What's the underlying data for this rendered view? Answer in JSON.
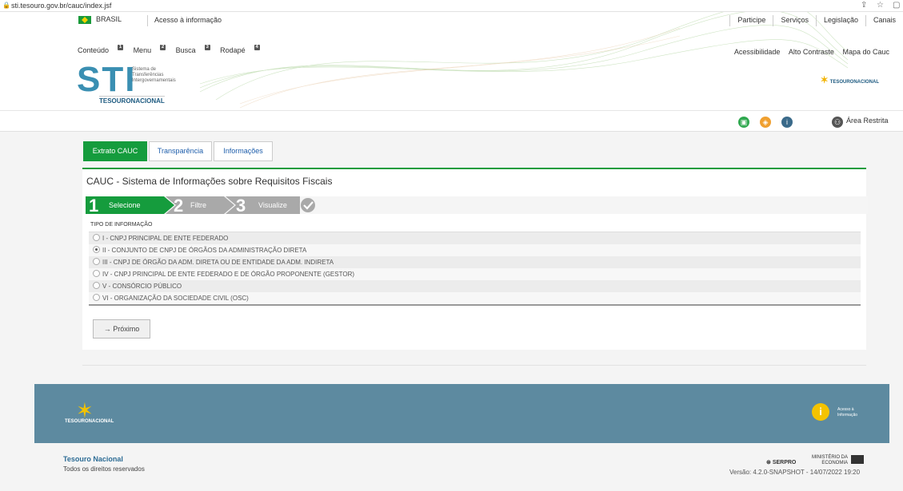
{
  "browser": {
    "url": "sti.tesouro.gov.br/cauc/index.jsf"
  },
  "header": {
    "brasil": "BRASIL",
    "acesso_informacao": "Acesso à informação",
    "right_links": [
      "Participe",
      "Serviços",
      "Legislação",
      "Canais"
    ],
    "shortcuts": [
      {
        "label": "Conteúdo",
        "key": "1"
      },
      {
        "label": "Menu",
        "key": "2"
      },
      {
        "label": "Busca",
        "key": "3"
      },
      {
        "label": "Rodapé",
        "key": "4"
      }
    ],
    "accessibility": [
      "Acessibilidade",
      "Alto Contraste",
      "Mapa do Cauc"
    ],
    "logo": "STI",
    "logo_subtitle": [
      "Sistema de",
      "Transferências",
      "Intergovernamentais"
    ],
    "logo_tesouro": "TESOURONACIONAL",
    "tesouro_right": "TESOURONACIONAL"
  },
  "iconbar": {
    "area_restrita": "Área Restrita"
  },
  "tabs": [
    {
      "label": "Extrato CAUC",
      "active": true
    },
    {
      "label": "Transparência",
      "active": false
    },
    {
      "label": "Informações",
      "active": false
    }
  ],
  "panel": {
    "title": "CAUC - Sistema de Informações sobre Requisitos Fiscais",
    "steps": [
      {
        "num": "1",
        "label": "Selecione"
      },
      {
        "num": "2",
        "label": "Filtre"
      },
      {
        "num": "3",
        "label": "Visualize"
      }
    ],
    "tipo_label": "TIPO DE INFORMAÇÃO",
    "options": [
      "I - CNPJ PRINCIPAL DE ENTE FEDERADO",
      "II - CONJUNTO DE CNPJ DE ÓRGÃOS DA ADMINISTRAÇÃO DIRETA",
      "III - CNPJ DE ÓRGÃO DA ADM. DIRETA OU DE ENTIDADE DA ADM. INDIRETA",
      "IV - CNPJ PRINCIPAL DE ENTE FEDERADO E DE ÓRGÃO PROPONENTE (GESTOR)",
      "V - CONSÓRCIO PÚBLICO",
      "VI - ORGANIZAÇÃO DA SOCIEDADE CIVIL (OSC)"
    ],
    "selected_index": 1,
    "next_button": "Próximo"
  },
  "footer": {
    "tesouro": "TESOURONACIONAL",
    "acesso_text": [
      "Acesso à",
      "Informação"
    ],
    "org": "Tesouro Nacional",
    "rights": "Todos os direitos reservados",
    "serpro": "SERPRO",
    "ministerio": [
      "MINISTÉRIO DA",
      "ECONOMIA"
    ],
    "versao": "Versão: 4.2.0-SNAPSHOT - 14/07/2022 19:20"
  },
  "colors": {
    "accent": "#159c3d",
    "link": "#1e5eab",
    "footer": "#5d8aa0"
  }
}
